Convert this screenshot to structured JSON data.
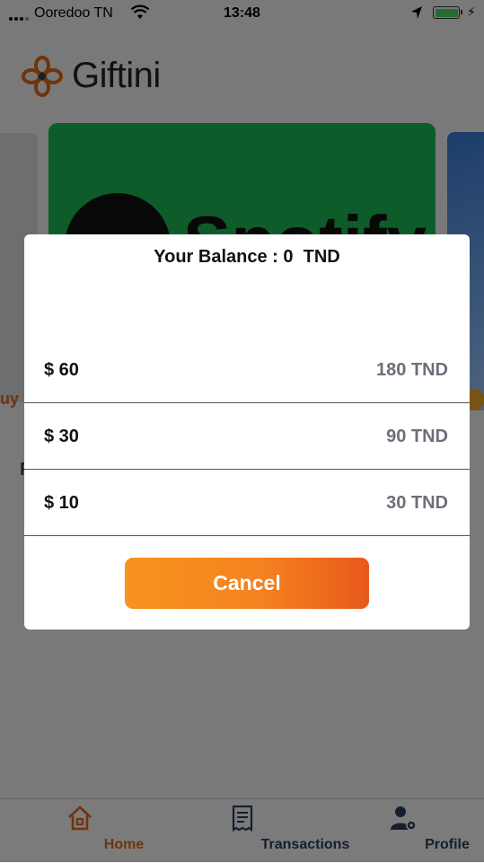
{
  "status_bar": {
    "carrier": "Ooredoo TN",
    "time": "13:48"
  },
  "app": {
    "name": "Giftini",
    "banner_text": "Spotify",
    "partial_buy_text": "uy",
    "partial_section_letter": "P"
  },
  "modal": {
    "balance_text": "Your Balance : 0  TND",
    "options": [
      {
        "amount": "$ 60",
        "price": "180 TND"
      },
      {
        "amount": "$ 30",
        "price": "90 TND"
      },
      {
        "amount": "$ 10",
        "price": "30 TND"
      }
    ],
    "cancel_label": "Cancel",
    "accent_color": "#f58220"
  },
  "tab_bar": {
    "tabs": [
      {
        "label": "Home",
        "icon": "home-icon",
        "active": true
      },
      {
        "label": "Transactions",
        "icon": "receipt-icon",
        "active": false
      },
      {
        "label": "Profile",
        "icon": "user-settings-icon",
        "active": false
      }
    ],
    "active_color": "#e0691a",
    "inactive_color": "#2a3e5c"
  }
}
